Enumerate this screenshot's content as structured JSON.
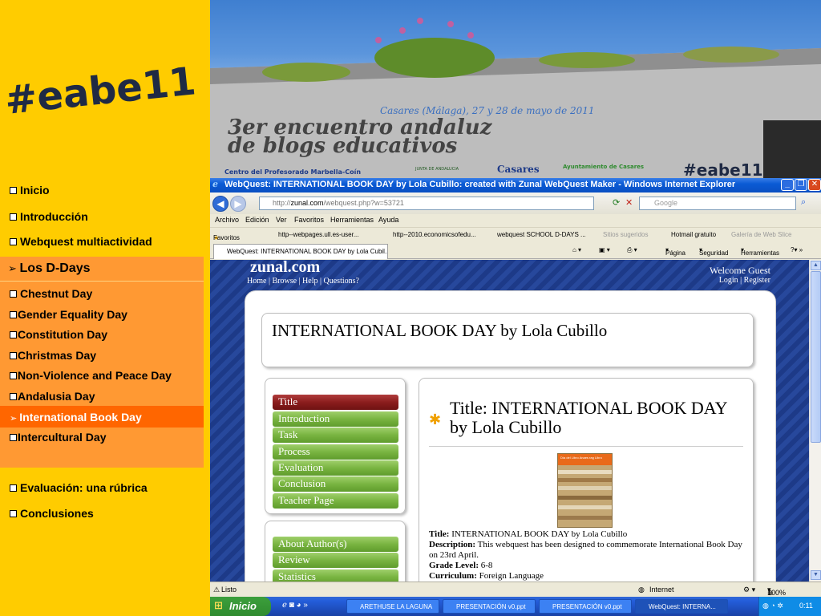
{
  "slide_nav": {
    "logo": "#eabe11",
    "items_top": [
      {
        "label": "Inicio"
      },
      {
        "label": "Introducción"
      },
      {
        "label": "Webquest multiactividad"
      }
    ],
    "section_header": "Los D-Days",
    "sub_items": [
      {
        "label": "Chestnut Day"
      },
      {
        "label": "Gender Equality Day"
      },
      {
        "label": "Constitution Day"
      },
      {
        "label": "Christmas Day"
      },
      {
        "label": "Non-Violence and Peace Day"
      },
      {
        "label": "Andalusia Day"
      },
      {
        "label": "International Book Day"
      },
      {
        "label": "Intercultural Day"
      }
    ],
    "items_bottom": [
      {
        "label": "Evaluación: una rúbrica"
      },
      {
        "label": "Conclusiones"
      }
    ]
  },
  "banner": {
    "location_date": "Casares (Málaga), 27 y 28 de mayo de 2011",
    "headline_1": "3er encuentro andaluz",
    "headline_2": "de blogs educativos",
    "cep": "Centro del Profesorado Marbella-Coín",
    "junta": "JUNTA DE ANDALUCIA",
    "casares": "Casares",
    "ayto": "Ayuntamiento de Casares",
    "hashtag": "#eabe11"
  },
  "browser": {
    "title": "WebQuest: INTERNATIONAL BOOK DAY by Lola Cubillo: created with Zunal WebQuest Maker - Windows Internet Explorer",
    "url_prefix": "http://",
    "url_domain": "zunal.com",
    "url_path": "/webquest.php?w=53721",
    "search_placeholder": "Google",
    "menu": [
      "Archivo",
      "Edición",
      "Ver",
      "Favoritos",
      "Herramientas",
      "Ayuda"
    ],
    "favorites_label": "Favoritos",
    "favorites": [
      "http--webpages.ull.es-user...",
      "http--2010.economicsofedu...",
      "webquest SCHOOL D-DAYS ...",
      "Sitios sugeridos",
      "Hotmail gratuito",
      "Galería de Web Slice"
    ],
    "tab_label": "WebQuest: INTERNATIONAL BOOK DAY by Lola Cubil...",
    "tab_tools": [
      "Página",
      "Seguridad",
      "Herramientas"
    ],
    "status_text": "Listo",
    "status_zone": "Internet",
    "zoom": "100%"
  },
  "zunal": {
    "logo": "zunal.com",
    "nav": [
      "Home",
      "Browse",
      "Help",
      "Questions?"
    ],
    "welcome": "Welcome Guest",
    "login": "Login",
    "register": "Register",
    "page_title": "INTERNATIONAL BOOK DAY by Lola Cubillo",
    "menu_main": [
      {
        "label": "Title",
        "active": true
      },
      {
        "label": "Introduction"
      },
      {
        "label": "Task"
      },
      {
        "label": "Process"
      },
      {
        "label": "Evaluation"
      },
      {
        "label": "Conclusion"
      },
      {
        "label": "Teacher Page"
      }
    ],
    "menu_secondary": [
      {
        "label": "About Author(s)"
      },
      {
        "label": "Review"
      },
      {
        "label": "Statistics"
      }
    ],
    "content_title": "Title: INTERNATIONAL BOOK DAY by Lola Cubillo",
    "book_image_title": "Día del Libro Anaes rag Libro",
    "details": {
      "title_label": "Title:",
      "title_value": "INTERNATIONAL BOOK DAY by Lola Cubillo",
      "description_label": "Description:",
      "description_value": "This webquest has been designed to commemorate International Book Day on 23rd April.",
      "grade_label": "Grade Level:",
      "grade_value": "6-8",
      "curriculum_label": "Curriculum:",
      "curriculum_value": "Foreign Language"
    }
  },
  "taskbar": {
    "start": "Inicio",
    "buttons": [
      "ARETHUSE LA LAGUNA",
      "PRESENTACIÓN v0.ppt",
      "PRESENTACIÓN v0.ppt",
      "WebQuest: INTERNA..."
    ],
    "clock": "0:11"
  },
  "colors": {
    "slide_bg": "#FFCC00",
    "nav_orange": "#FF9933",
    "nav_active": "#FF6600",
    "zunal_blue": "#1d3a88",
    "button_green": "#79b441",
    "button_active": "#8b1d1d"
  }
}
